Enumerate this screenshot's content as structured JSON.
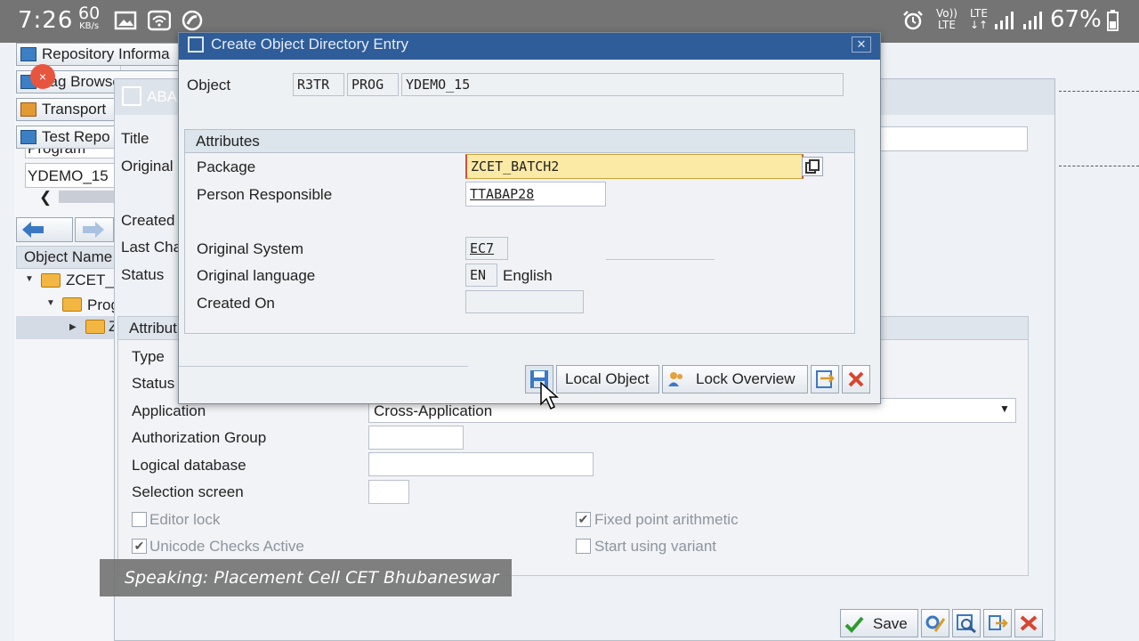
{
  "status_bar": {
    "time": "7:26",
    "speed_value": "60",
    "speed_unit": "KB/s",
    "network_left": "Vo)) LTE",
    "network_right": "LTE ↓↑",
    "battery": "67%"
  },
  "background": {
    "toolbar_buttons": [
      "Repository Informa",
      "Tag Browser",
      "Transport",
      "Test Repo"
    ],
    "object_selector_label": "Program",
    "object_value": "YDEMO_15",
    "tree_header": "Object Name",
    "tree_items": [
      "ZCET_",
      "Prog",
      "Z"
    ],
    "window_title": "ABAP",
    "form_labels": [
      "Title",
      "Original l",
      "Created",
      "Last Cha",
      "Status"
    ],
    "attributes_heading": "Attribut",
    "attr_labels": [
      "Type",
      "Status",
      "Application",
      "Authorization Group",
      "Logical database",
      "Selection screen"
    ],
    "application_value": "Cross-Application",
    "checkboxes": {
      "editor_lock": {
        "label": "Editor lock",
        "checked": false
      },
      "unicode_checks": {
        "label": "Unicode Checks Active",
        "checked": true
      },
      "fixed_point": {
        "label": "Fixed point arithmetic",
        "checked": true
      },
      "start_variant": {
        "label": "Start using variant",
        "checked": false
      }
    },
    "save_label": "Save"
  },
  "dialog": {
    "title": "Create Object Directory Entry",
    "object_label": "Object",
    "object_pgmid": "R3TR",
    "object_type": "PROG",
    "object_name": "YDEMO_15",
    "attributes_heading": "Attributes",
    "package_label": "Package",
    "package_value": "ZCET_BATCH2",
    "person_label": "Person Responsible",
    "person_value": "TTABAP28",
    "orig_system_label": "Original System",
    "orig_system_value": "EC7",
    "orig_lang_label": "Original language",
    "orig_lang_code": "EN",
    "orig_lang_name": "English",
    "created_on_label": "Created On",
    "created_on_value": "",
    "local_object_label": "Local Object",
    "lock_overview_label": "Lock Overview"
  },
  "caption": "Speaking: Placement Cell CET Bhubaneswar",
  "colors": {
    "dialog_title": "#2f5d9a",
    "focus_field": "#fbeaa5",
    "cancel_red": "#d9452f",
    "status_bar": "#747474"
  }
}
